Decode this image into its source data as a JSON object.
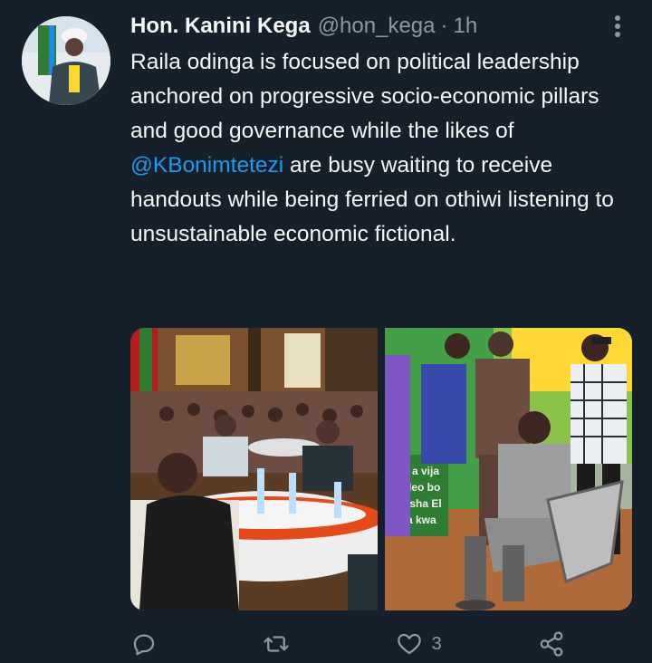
{
  "tweet": {
    "author_name": "Hon. Kanini Kega",
    "author_handle": "@hon_kega",
    "separator": "·",
    "time": "1h",
    "text_part1": "Raila odinga is focused on political leadership anchored on progressive socio-economic pillars and good governance while the likes of ",
    "mention": "@KBonimtetezi",
    "text_part2": " are busy waiting to receive handouts while being ferried on othiwi listening to unsustainable economic fictional.",
    "photo_left_text": "",
    "photo_right_sign_text": "a vija\nleo bo\nisha El\na kwa"
  },
  "actions": {
    "reply_count": "",
    "retweet_count": "",
    "like_count": "3"
  },
  "icons": {
    "more": "more-vertical-icon",
    "reply": "reply-icon",
    "retweet": "retweet-icon",
    "like": "heart-icon",
    "share": "share-icon"
  },
  "colors": {
    "background": "#15202b",
    "text": "#f7f9f9",
    "secondary": "#8b98a5",
    "link": "#1d9bf0"
  }
}
